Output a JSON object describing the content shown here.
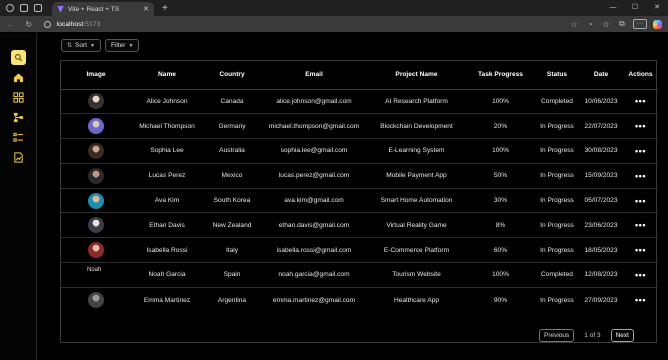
{
  "browser": {
    "tab_title": "Vite + React + TS",
    "url_host": "localhost",
    "url_port": ":5173"
  },
  "colors": {
    "accent": "#f7e37a",
    "background": "#000000",
    "border": "#3a3a3a"
  },
  "toolbar": {
    "sort_label": "Sort",
    "filter_label": "Filter"
  },
  "table": {
    "headers": [
      "Image",
      "Name",
      "Country",
      "Email",
      "Project Name",
      "Task Progress",
      "Status",
      "Date",
      "Actions"
    ],
    "rows": [
      {
        "name": "Alice Johnson",
        "country": "Canada",
        "email": "alice.johnson@gmail.com",
        "project": "AI Research Platform",
        "progress": "100%",
        "status": "Completed",
        "date": "10/06/2023",
        "action": "•••"
      },
      {
        "name": "Michael Thompson",
        "country": "Germany",
        "email": "michael.thompson@gmail.com",
        "project": "Blockchain Development",
        "progress": "20%",
        "status": "In Progress",
        "date": "22/07/2023",
        "action": "•••"
      },
      {
        "name": "Sophia Lee",
        "country": "Australia",
        "email": "sophia.lee@gmail.com",
        "project": "E-Learning System",
        "progress": "100%",
        "status": "In Progress",
        "date": "30/08/2023",
        "action": "•••"
      },
      {
        "name": "Lucas Perez",
        "country": "Mexico",
        "email": "lucas.perez@gmail.com",
        "project": "Mobile Payment App",
        "progress": "50%",
        "status": "In Progress",
        "date": "15/09/2023",
        "action": "•••"
      },
      {
        "name": "Ava Kim",
        "country": "South Korea",
        "email": "ava.kim@gmail.com",
        "project": "Smart Home Automation",
        "progress": "30%",
        "status": "In Progress",
        "date": "05/07/2023",
        "action": "•••"
      },
      {
        "name": "Ethan Davis",
        "country": "New Zealand",
        "email": "ethan.davis@gmail.com",
        "project": "Virtual Reality Game",
        "progress": "8%",
        "status": "In Progress",
        "date": "23/06/2023",
        "action": "•••"
      },
      {
        "name": "Isabella Rossi",
        "country": "Italy",
        "email": "isabella.rossi@gmail.com",
        "project": "E-Commerce Platform",
        "progress": "60%",
        "status": "In Progress",
        "date": "18/05/2023",
        "action": "•••"
      },
      {
        "name": "Noah Garcia",
        "country": "Spain",
        "email": "noah.garcia@gmail.com",
        "project": "Tourism Website",
        "progress": "100%",
        "status": "Completed",
        "date": "12/08/2023",
        "action": "•••"
      },
      {
        "name": "Emma Martinez",
        "country": "Argentina",
        "email": "emma.martinez@gmail.com",
        "project": "Healthcare App",
        "progress": "90%",
        "status": "In Progress",
        "date": "27/09/2023",
        "action": "•••"
      }
    ],
    "broken_image_alt": "Noah"
  },
  "pagination": {
    "previous_label": "Previous",
    "page_info": "1 of 3",
    "next_label": "Next"
  }
}
